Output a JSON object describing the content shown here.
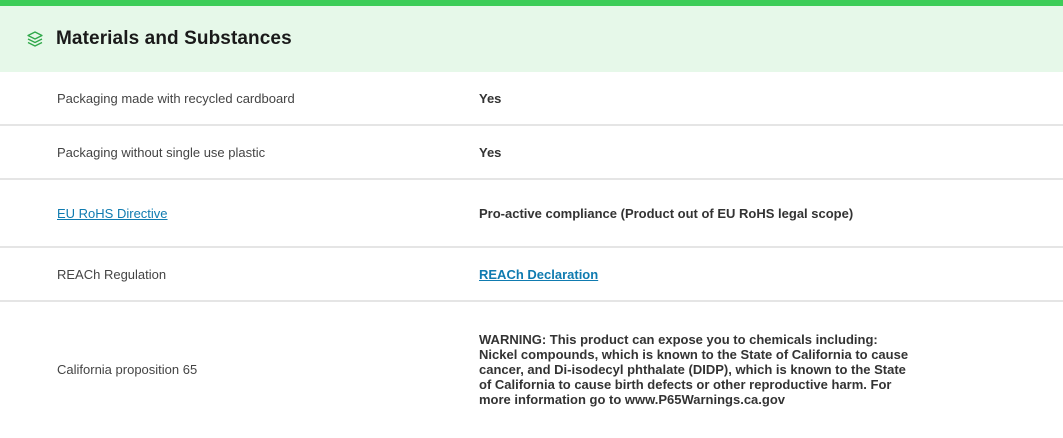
{
  "section": {
    "title": "Materials and Substances",
    "icon": "layers-icon",
    "accent_color": "#3dcd58",
    "header_bg": "#e6f8e9"
  },
  "rows": [
    {
      "label": "Packaging made with recycled cardboard",
      "value": "Yes"
    },
    {
      "label": "Packaging without single use plastic",
      "value": "Yes"
    },
    {
      "label": "EU RoHS Directive",
      "value": "Pro-active compliance (Product out of EU RoHS legal scope)"
    },
    {
      "label": "REACh Regulation",
      "value": "REACh Declaration"
    },
    {
      "label": "California proposition 65",
      "value": "WARNING: This product can expose you to chemicals including: Nickel compounds, which is known to the State of California to cause cancer, and Di-isodecyl phthalate (DIDP), which is known to the State of California to cause birth defects or other reproductive harm. For more information go to www.P65Warnings.ca.gov"
    }
  ],
  "link_color": "#0f7bb0"
}
